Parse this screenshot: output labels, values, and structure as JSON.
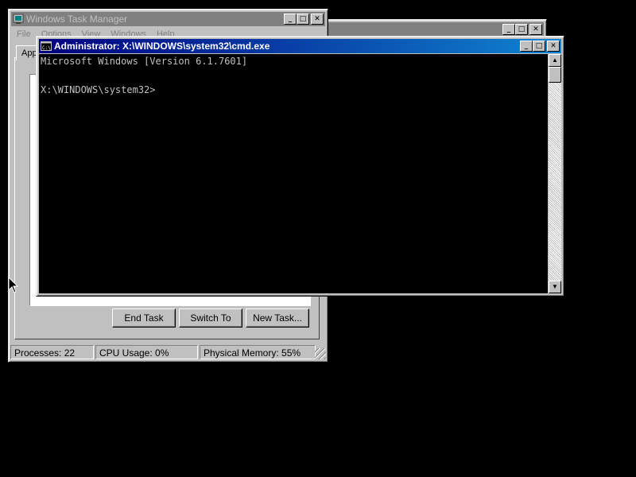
{
  "taskmanager": {
    "title": "Windows Task Manager",
    "menu": [
      "File",
      "Options",
      "View",
      "Windows",
      "Help"
    ],
    "tab_label": "App",
    "buttons": {
      "end_task": "End Task",
      "switch_to": "Switch To",
      "new_task": "New Task..."
    },
    "status": {
      "processes": "Processes: 22",
      "cpu": "CPU Usage: 0%",
      "memory": "Physical Memory: 55%"
    }
  },
  "cmd": {
    "title": "Administrator: X:\\WINDOWS\\system32\\cmd.exe",
    "lines": [
      "Microsoft Windows [Version 6.1.7601]",
      "",
      "X:\\WINDOWS\\system32>"
    ]
  },
  "colors": {
    "title_active": "#000080",
    "title_inactive": "#808080",
    "desktop": "#000000"
  },
  "icons": [
    "taskmanager-icon",
    "cmd-icon",
    "minimize-icon",
    "maximize-icon",
    "close-icon",
    "scroll-up-icon",
    "scroll-down-icon",
    "mouse-pointer-icon"
  ]
}
